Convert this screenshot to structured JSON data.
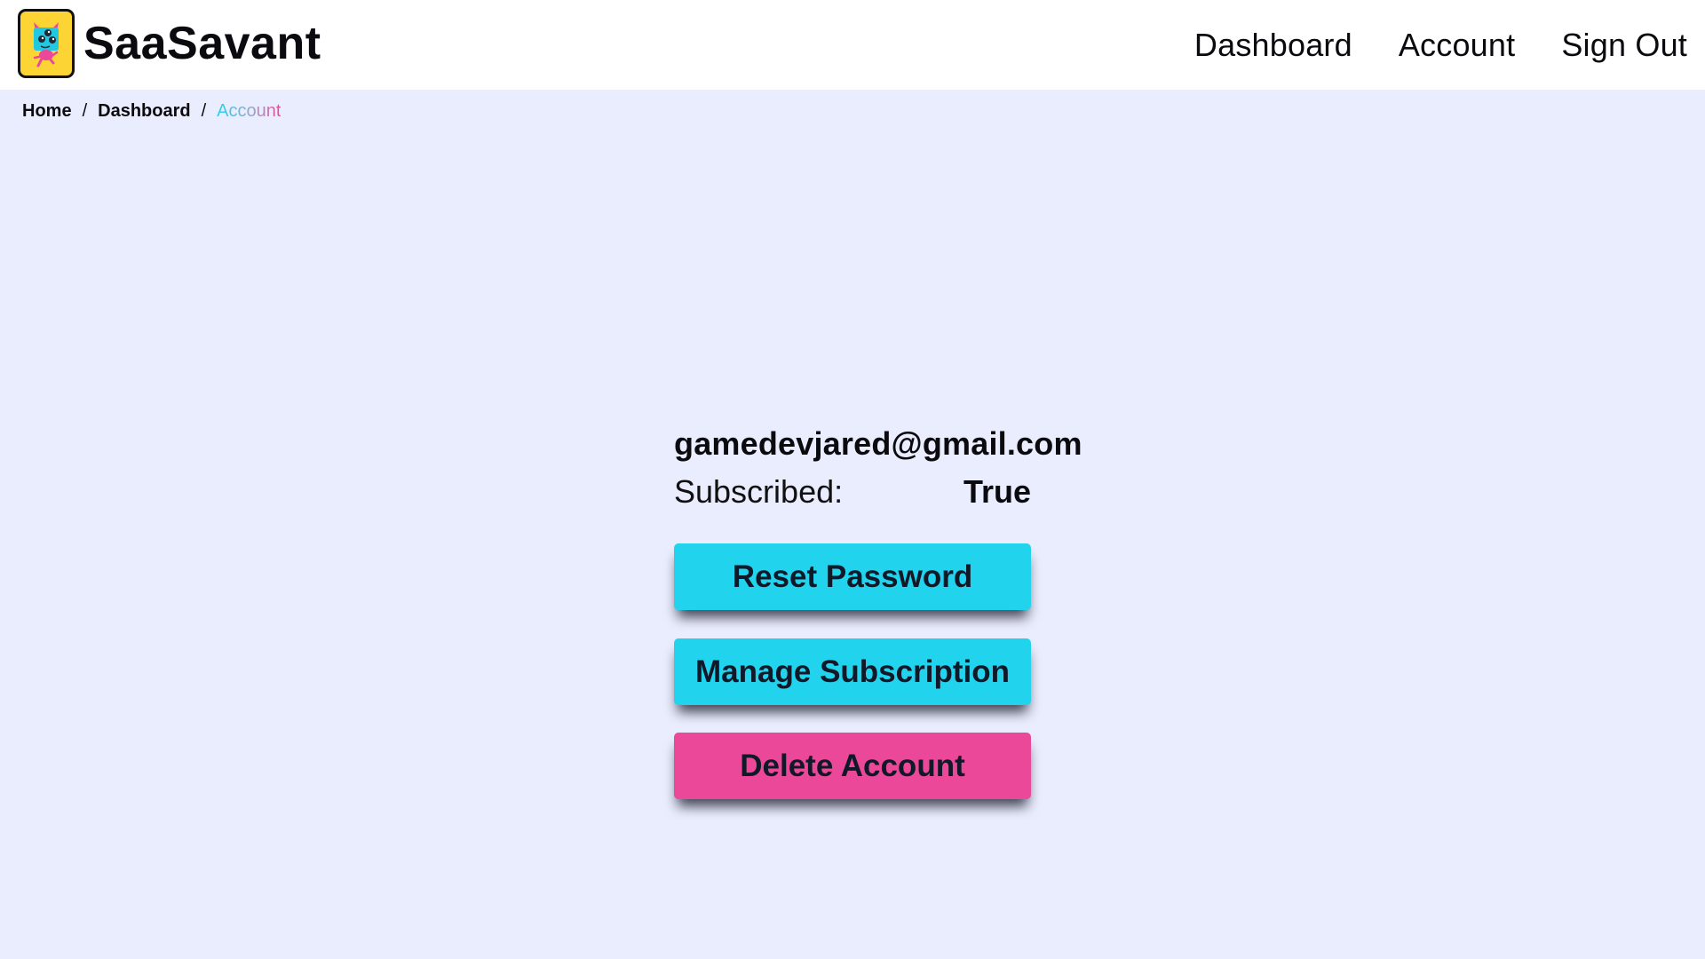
{
  "header": {
    "brand_name": "SaaSavant",
    "logo_icon": "monster-mascot-icon",
    "nav": [
      {
        "label": "Dashboard"
      },
      {
        "label": "Account"
      },
      {
        "label": "Sign Out"
      }
    ]
  },
  "breadcrumb": {
    "items": [
      {
        "label": "Home"
      },
      {
        "label": "Dashboard"
      },
      {
        "label": "Account"
      }
    ],
    "separator": "/"
  },
  "account": {
    "email": "gamedevjared@gmail.com",
    "subscribed_label": "Subscribed:",
    "subscribed_value": "True",
    "buttons": {
      "reset_password": "Reset Password",
      "manage_subscription": "Manage Subscription",
      "delete_account": "Delete Account"
    }
  },
  "colors": {
    "background": "#EAEDFD",
    "primary": "#22D3EE",
    "danger": "#EC4899",
    "logo_bg": "#FCD535"
  }
}
